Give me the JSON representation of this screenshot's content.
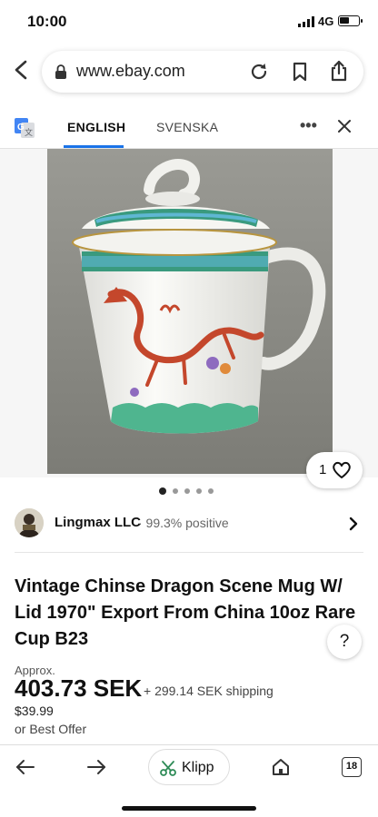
{
  "status_bar": {
    "time": "10:00",
    "network": "4G",
    "battery_level": 0.5
  },
  "browser": {
    "url": "www.ebay.com",
    "icons": [
      "back-arrow-icon",
      "lock-icon",
      "reload-icon",
      "bookmark-icon",
      "share-icon"
    ]
  },
  "translate_bar": {
    "lang_active": "ENGLISH",
    "lang_other": "SVENSKA",
    "more_label": "•••"
  },
  "product": {
    "image_description_icon": "dragon-mug-photo",
    "like_count": "1",
    "dots_total": 5,
    "dots_active": 0,
    "title": "Vintage Chinse Dragon Scene Mug W/ Lid 1970\" Export From China 10oz Rare Cup B23",
    "approx_label": "Approx.",
    "price": "403.73 SEK",
    "shipping": "+ 299.14 SEK shipping",
    "original_price": "$39.99",
    "best_offer": "or Best Offer"
  },
  "seller": {
    "name": "Lingmax LLC",
    "rating": "· 99.3% positive"
  },
  "help_label": "?",
  "bottom_nav": {
    "klipp_label": "Klipp",
    "tab_count": "18"
  },
  "colors": {
    "accent_blue": "#1a73e8",
    "mug_red": "#c4472c",
    "mug_green": "#3fae86"
  }
}
